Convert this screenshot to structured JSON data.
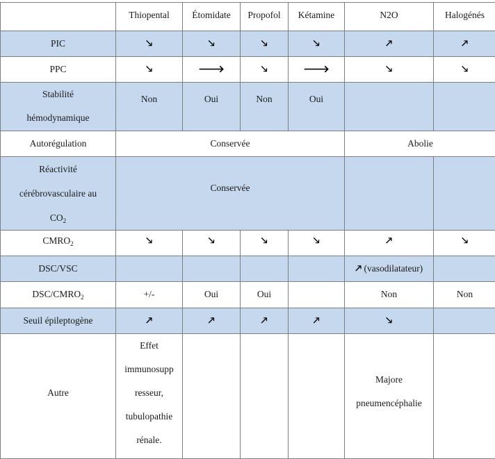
{
  "table": {
    "headers": [
      "",
      "Thiopental",
      "Étomidate",
      "Propofol",
      "Kétamine",
      "N2O",
      "Halogénés"
    ],
    "arrows": {
      "down": "🡖",
      "up": "🡕",
      "right": "🡒"
    },
    "rows": {
      "pic": {
        "label": "PIC",
        "values": [
          "🡖",
          "🡖",
          "🡖",
          "🡖",
          "🡕",
          "🡕"
        ],
        "meaning": [
          "decrease",
          "decrease",
          "decrease",
          "decrease",
          "increase",
          "increase"
        ]
      },
      "ppc": {
        "label": "PPC",
        "values": [
          "🡖",
          "🡒",
          "🡖",
          "🡒",
          "🡖",
          "🡖"
        ],
        "meaning": [
          "decrease",
          "stable",
          "decrease",
          "stable",
          "decrease",
          "decrease"
        ]
      },
      "stabilite": {
        "label_line1": "Stabilité",
        "label_line2": "hémodynamique",
        "values": [
          "Non",
          "Oui",
          "Non",
          "Oui",
          "",
          ""
        ]
      },
      "autoregulation": {
        "label": "Autorégulation",
        "conservee": "Conservée",
        "abolie": "Abolie"
      },
      "reactivite": {
        "label_line1": "Réactivité",
        "label_line2": "cérébrovasculaire au",
        "label_line3": "CO",
        "label_sub": "2",
        "value": "Conservée"
      },
      "cmro2": {
        "label": "CMRO",
        "label_sub": "2",
        "values": [
          "🡖",
          "🡖",
          "🡖",
          "🡖",
          "🡕",
          "🡖"
        ],
        "meaning": [
          "decrease",
          "decrease",
          "decrease",
          "decrease",
          "increase",
          "decrease"
        ]
      },
      "dsc_vsc": {
        "label": "DSC/VSC",
        "n2o_arrow": "🡕",
        "n2o_text": " (vasodilatateur)"
      },
      "dsc_cmro2": {
        "label": "DSC/CMRO",
        "label_sub": "2",
        "values": [
          "+/-",
          "Oui",
          "Oui",
          "",
          "Non",
          "Non"
        ]
      },
      "seuil": {
        "label": "Seuil épileptogène",
        "values": [
          "🡕",
          "🡕",
          "🡕",
          "🡕",
          "🡖",
          ""
        ],
        "meaning": [
          "increase",
          "increase",
          "increase",
          "increase",
          "decrease",
          ""
        ]
      },
      "autre": {
        "label": "Autre",
        "thiopental_lines": [
          "Effet",
          "immunosupp",
          "resseur,",
          "tubulopathie",
          "rénale."
        ],
        "n2o_lines": [
          "Majore",
          "pneumencéphalie"
        ]
      }
    }
  },
  "colors": {
    "row_blue": "#c6d8ee",
    "border": "#7a7f86"
  }
}
